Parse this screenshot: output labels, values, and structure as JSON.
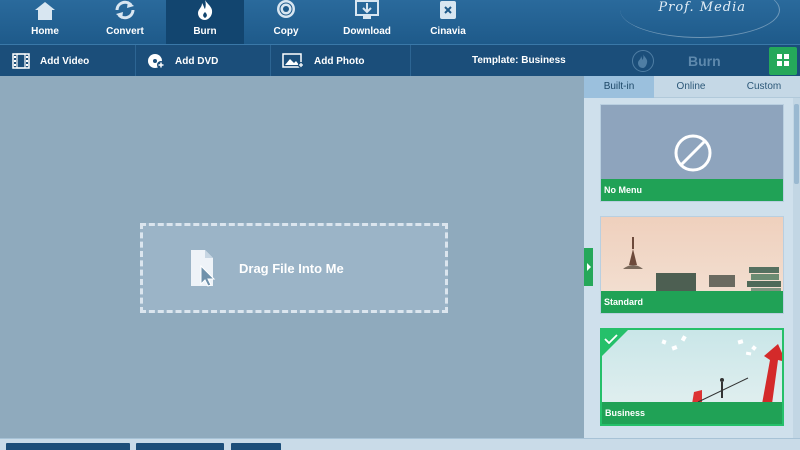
{
  "nav": {
    "items": [
      {
        "label": "Home",
        "icon": "home-icon"
      },
      {
        "label": "Convert",
        "icon": "convert-icon"
      },
      {
        "label": "Burn",
        "icon": "burn-icon",
        "active": true
      },
      {
        "label": "Copy",
        "icon": "copy-icon"
      },
      {
        "label": "Download",
        "icon": "download-icon"
      },
      {
        "label": "Cinavia",
        "icon": "cinavia-icon"
      }
    ],
    "brand": "Prof. Media"
  },
  "toolbar": {
    "add_video": "Add Video",
    "add_dvd": "Add DVD",
    "add_photo": "Add Photo",
    "template_label": "Template: Business",
    "burn_label": "Burn"
  },
  "workarea": {
    "drop_label": "Drag File Into Me"
  },
  "panel": {
    "tabs": [
      {
        "label": "Built-in",
        "active": true
      },
      {
        "label": "Online"
      },
      {
        "label": "Custom"
      }
    ],
    "templates": [
      {
        "name": "No Menu"
      },
      {
        "name": "Standard"
      },
      {
        "name": "Business",
        "selected": true
      }
    ]
  },
  "colors": {
    "accent_green": "#20a256",
    "nav_blue": "#1e5a8a",
    "work_bg": "#8faabd"
  }
}
